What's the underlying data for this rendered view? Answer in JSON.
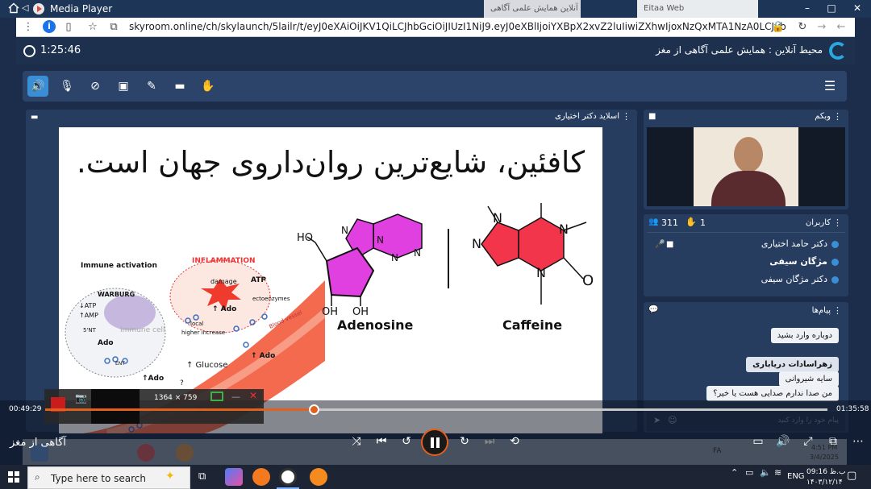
{
  "media_player": {
    "title": "Media Player"
  },
  "browser": {
    "background_tabs": [
      "محیط آنلاین",
      "همایش علمی آگاهی",
      "Eitaa Web"
    ],
    "url": "skyroom.online/ch/skylaunch/5lailr/t/eyJ0eXAiOiJKV1QiLCJhbGciOiJIUzI1NiJ9.eyJ0eXBlIjoiYXBpX2xvZ2luIiwiZXhwIjoxNzQxMTA1NzA0LCJyb29tX2lkIjo1Mzc2ODM3LCJ1a..."
  },
  "skyroom": {
    "timer": "1:25:46",
    "room_title": "محیط آنلاین : همایش علمی آگاهی از مغز",
    "toolbar": [
      "speaker-icon",
      "mic-off-icon",
      "camera-off-icon",
      "screen-share-icon",
      "brush-icon",
      "folder-icon",
      "raise-hand-icon"
    ]
  },
  "slides": {
    "header": "اسلاید دکتر اختیاری",
    "title": "کافئین، شایع‌ترین روان‌داروی جهان است.",
    "labels": {
      "immune_activation": "Immune activation",
      "inflammation": "INFLAMMATION",
      "warburg": "WARBURG",
      "atp_down": "↓ATP",
      "amp_up": "↑AMP",
      "nt5": "5'NT",
      "ado": "Ado",
      "immune_cell": "Immune cell",
      "damage": "damage",
      "atp": "ATP",
      "ecto": "ectoenzymes",
      "ado_up": "↑ Ado",
      "local": "local",
      "higher_increase": "higher increase",
      "blood_vessel": "Blood vessel",
      "glucose": "↑ Glucose",
      "ent": "ENT",
      "ado_up2": "↑Ado",
      "ado_up3": "↑ Ado",
      "q": "?",
      "ho": "HO",
      "oh1": "OH",
      "oh2": "OH",
      "adenosine": "Adenosine",
      "caffeine": "Caffeine",
      "n": "N",
      "o": "O"
    }
  },
  "webcam": {
    "header": "وبکم"
  },
  "users": {
    "header": "کاربران",
    "count": "311",
    "hands": "1",
    "list": [
      "دکتر حامد اختیاری",
      "مژگان سیفی",
      "دکتر مژگان سیفی"
    ]
  },
  "messages": {
    "header": "پیام‌ها",
    "items": [
      "دوباره وارد بشید",
      "زهراسادات دریاباری",
      "سایه شیروانی",
      "من صدا ندارم صدایی هست یا خیر؟"
    ],
    "input_placeholder": "پیام خود را وارد کنید"
  },
  "player": {
    "current_time": "00:49:29",
    "total_time": "01:35:58",
    "progress": 0.343,
    "now_playing": "آگاهی از مغز"
  },
  "snip": {
    "dimensions": "1364 × 759"
  },
  "inner_taskbar": {
    "lang": "FA",
    "time": "4:51 PM",
    "date": "3/4/2025"
  },
  "taskbar": {
    "search_placeholder": "Type here to search",
    "lang": "ENG",
    "time": "ب.ظ 09:16",
    "date": "۱۴۰۳/۱۲/۱۴"
  },
  "colors": {
    "accent": "#e0601c",
    "panel": "#263d60",
    "header": "#1d314f"
  }
}
